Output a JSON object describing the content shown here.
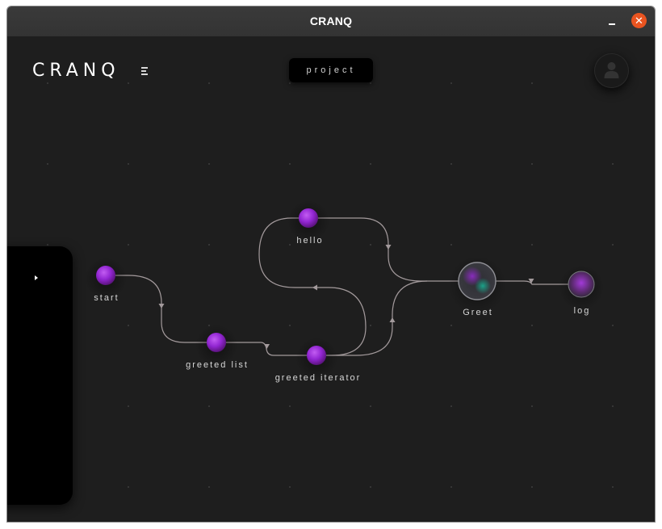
{
  "window": {
    "title": "CRANQ",
    "minimize_icon": "minimize-icon",
    "close_icon": "close-icon",
    "close_color": "#e95420"
  },
  "header": {
    "logo_text": "CRANQ",
    "menu_icon": "menu-icon",
    "project_label": "project",
    "avatar_icon": "user-icon"
  },
  "side_panel": {
    "toggle_icon": "caret-right-icon"
  },
  "graph": {
    "colors": {
      "node": "#9b30d9",
      "edge": "#a39a9c",
      "background": "#1e1e1e"
    },
    "nodes": [
      {
        "id": "start",
        "label": "start"
      },
      {
        "id": "greeted-list",
        "label": "greeted list"
      },
      {
        "id": "greeted-iterator",
        "label": "greeted iterator"
      },
      {
        "id": "hello",
        "label": "hello"
      },
      {
        "id": "greet",
        "label": "Greet"
      },
      {
        "id": "log",
        "label": "log"
      }
    ]
  }
}
